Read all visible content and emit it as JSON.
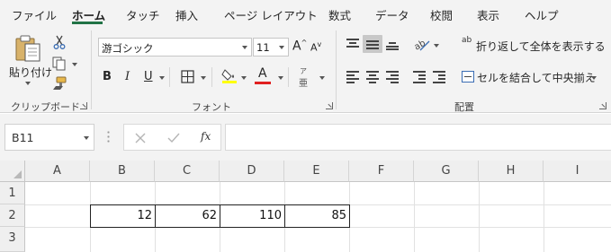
{
  "tabs": [
    "ファイル",
    "ホーム",
    "タッチ",
    "挿入",
    "ページ レイアウト",
    "数式",
    "データ",
    "校閲",
    "表示",
    "ヘルプ"
  ],
  "active_tab": "ホーム",
  "colors": {
    "accent": "#217346",
    "highlight": "#ffff00",
    "font_color": "#ff0000",
    "ribbon_bg": "#f3f3f3"
  },
  "clipboard": {
    "paste_label": "貼り付け",
    "group_label": "クリップボード"
  },
  "font": {
    "name": "游ゴシック",
    "size": "11",
    "grow_label": "A",
    "shrink_label": "A",
    "bold": "B",
    "italic": "I",
    "underline": "U",
    "font_color_letter": "A",
    "phonetic_top": "ア",
    "phonetic_bottom": "亜",
    "group_label": "フォント"
  },
  "alignment": {
    "wrap_text_label": "折り返して全体を表示する",
    "wrap_icon_text": "ab",
    "merge_label": "セルを結合して中央揃え",
    "group_label": "配置"
  },
  "formula_bar": {
    "name_box": "B11",
    "fx": "fx",
    "formula": ""
  },
  "columns": [
    "A",
    "B",
    "C",
    "D",
    "E",
    "F",
    "G",
    "H",
    "I"
  ],
  "rows": [
    "1",
    "2",
    "3"
  ],
  "cells": {
    "B2": "12",
    "C2": "62",
    "D2": "110",
    "E2": "85"
  }
}
